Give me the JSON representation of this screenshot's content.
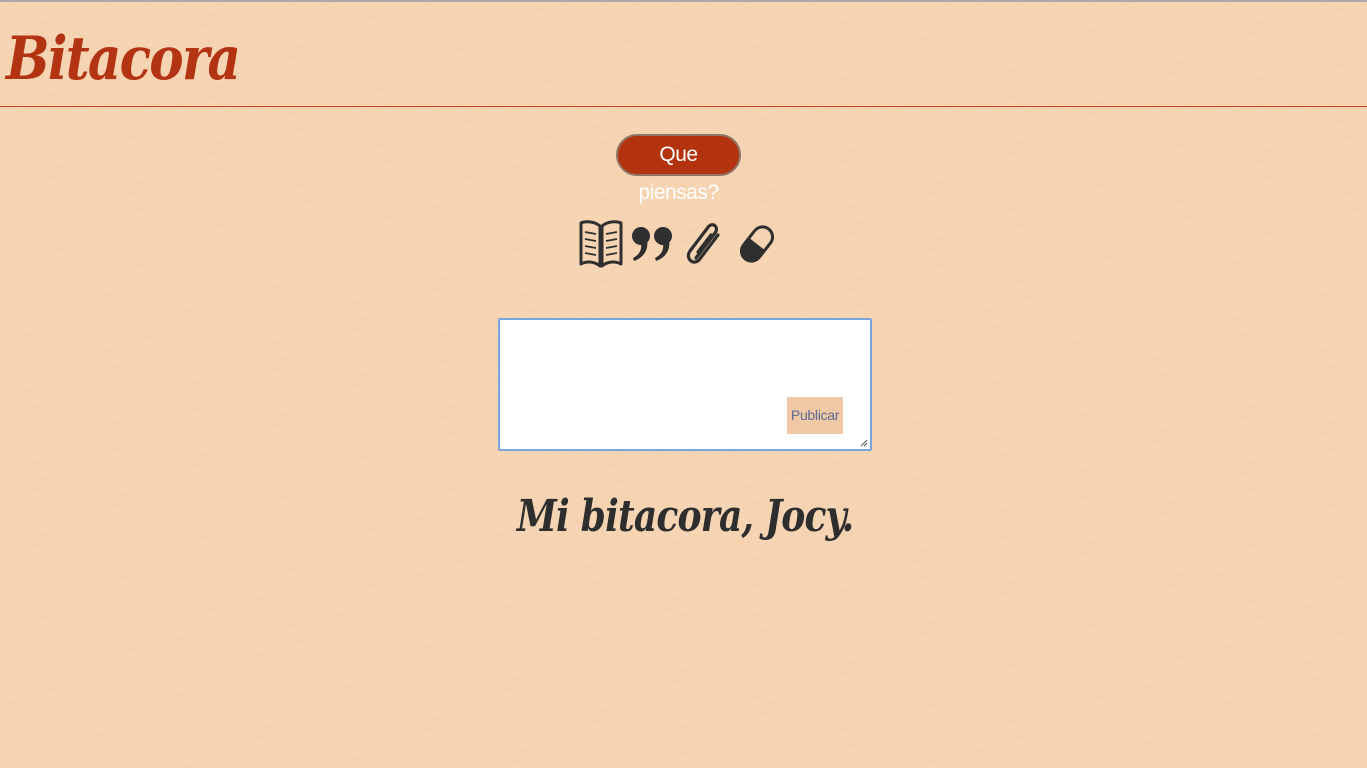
{
  "header": {
    "brand_title": "Bitacora"
  },
  "composer": {
    "prompt_button_label": "Que piensas?",
    "text_value": "",
    "publish_label": "Publicar"
  },
  "icons": [
    {
      "name": "open-book-icon"
    },
    {
      "name": "quote-icon"
    },
    {
      "name": "paperclip-icon"
    },
    {
      "name": "pill-icon"
    }
  ],
  "footer": {
    "signature": "Mi bitacora, Jocy."
  },
  "colors": {
    "background": "#f6d4b2",
    "accent": "#b3330f",
    "text_dark": "#2f2f2f",
    "focus_border": "#7aa5dc",
    "publish_bg": "#efc8a6"
  }
}
